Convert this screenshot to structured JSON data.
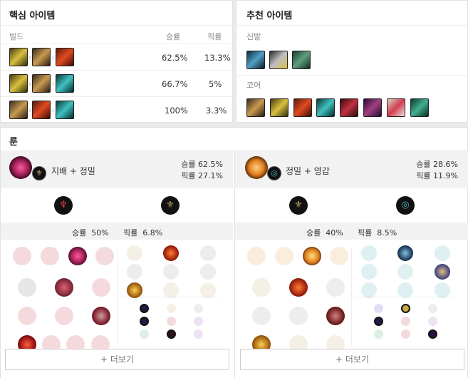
{
  "core_items": {
    "title": "핵심 아이템",
    "col_build": "빌드",
    "col_winrate": "승률",
    "col_pickrate": "픽률",
    "builds": [
      {
        "items": [
          "item-stormrazor",
          "item-infinity-edge",
          "item-bloodthirster"
        ],
        "winrate": "62.5%",
        "pickrate": "13.3%"
      },
      {
        "items": [
          "item-stormrazor",
          "item-infinity-edge",
          "item-immortal-shieldbow"
        ],
        "winrate": "66.7%",
        "pickrate": "5%"
      },
      {
        "items": [
          "item-infinity-edge",
          "item-bloodthirster",
          "item-immortal-shieldbow"
        ],
        "winrate": "100%",
        "pickrate": "3.3%"
      }
    ]
  },
  "recommended_items": {
    "title": "추천 아이템",
    "boots_label": "신발",
    "boots": [
      "item-berserker-greaves",
      "item-steelcaps",
      "item-mercury-treads"
    ],
    "core_label": "코어",
    "core": [
      "item-infinity-edge",
      "item-stormrazor",
      "item-bloodthirster",
      "item-immortal-shieldbow",
      "item-essence-reaver",
      "item-navori",
      "item-guardian-angel",
      "item-rapid-firecannon"
    ]
  },
  "runes": {
    "title": "룬",
    "more_label": "+ 더보기",
    "pages": [
      {
        "name": "지배 + 정밀",
        "winrate": "승률 62.5%",
        "pickrate": "픽률 27.1%",
        "stat_winrate": "승률  50%",
        "stat_pickrate": "픽률  6.8%",
        "primary_icon": "domination-icon",
        "secondary_icon": "precision-icon"
      },
      {
        "name": "정밀 + 영감",
        "winrate": "승률 28.6%",
        "pickrate": "픽률 11.9%",
        "stat_winrate": "승률  40%",
        "stat_pickrate": "픽률  8.5%",
        "primary_icon": "precision-icon",
        "secondary_icon": "inspiration-icon"
      }
    ]
  },
  "colors": {
    "domination": "#c8303a",
    "precision": "#c8aa6e",
    "inspiration": "#49aab9"
  }
}
